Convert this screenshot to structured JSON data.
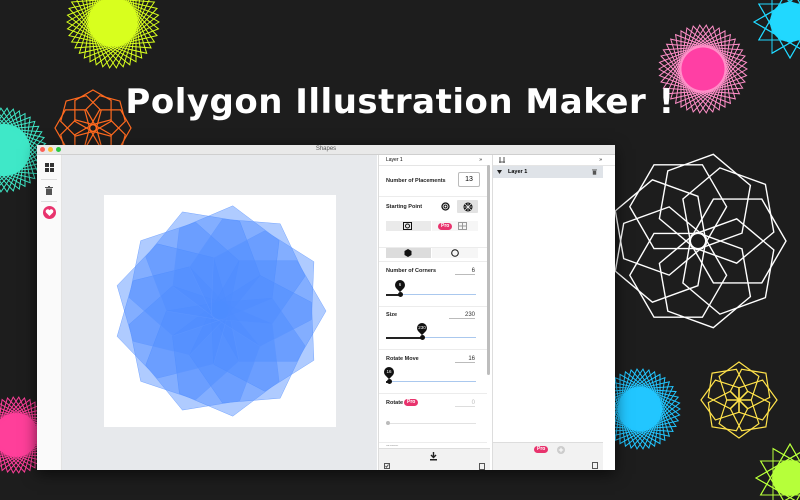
{
  "headline": "Polygon Illustration Maker !",
  "window": {
    "title": "Shapes"
  },
  "colors": {
    "shape": "#4d8bff",
    "pro": "#e8336d",
    "layer_row": "#dfe3e8"
  },
  "toolbar": {
    "icons": [
      "grid-icon",
      "trash-icon",
      "heart-icon"
    ]
  },
  "properties": {
    "title": "Layer 1",
    "collapse_icon": "»",
    "placements": {
      "label": "Number of Placements",
      "value": "13"
    },
    "starting_point": {
      "label": "Starting Point"
    },
    "pro_label": "Pro",
    "corners": {
      "label": "Number of Corners",
      "value": "6",
      "pin": "6",
      "fraction": 0.15
    },
    "size": {
      "label": "Size",
      "value": "230",
      "pin": "230",
      "fraction": 0.4
    },
    "rotate_move": {
      "label": "Rotate Move",
      "value": "16",
      "pin": "16",
      "fraction": 0.03
    },
    "rotate": {
      "label": "Rotate",
      "value": "0"
    },
    "next_label": "Scale"
  },
  "layers": {
    "collapse_icon": "»",
    "items": [
      {
        "name": "Layer 1"
      }
    ],
    "pro_label": "Pro"
  }
}
